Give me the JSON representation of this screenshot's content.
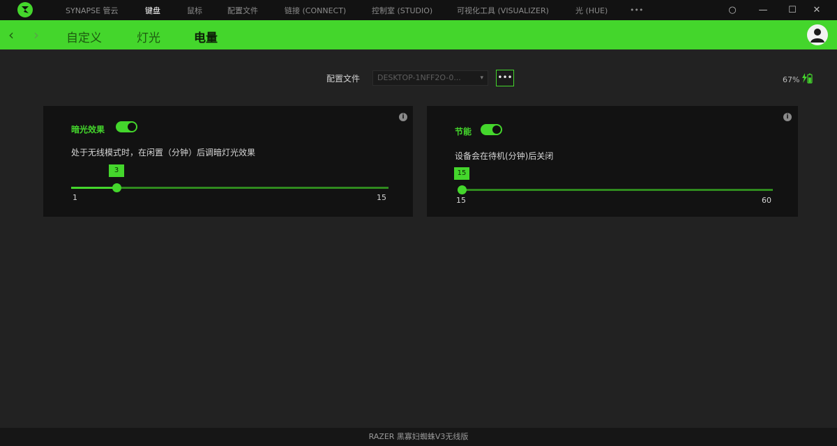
{
  "titlebar": {
    "nav_items": [
      {
        "label": "SYNAPSE 管云",
        "active": false
      },
      {
        "label": "键盘",
        "active": true
      },
      {
        "label": "鼠标",
        "active": false
      },
      {
        "label": "配置文件",
        "active": false
      },
      {
        "label": "链接 (CONNECT)",
        "active": false
      },
      {
        "label": "控制室 (STUDIO)",
        "active": false
      },
      {
        "label": "可视化工具 (VISUALIZER)",
        "active": false
      },
      {
        "label": "光 (HUE)",
        "active": false
      },
      {
        "label": "•••",
        "active": false
      }
    ],
    "window_controls": {
      "record": "○",
      "minimize": "—",
      "maximize": "☐",
      "close": "✕"
    }
  },
  "subnav": {
    "back": "‹",
    "forward": "›",
    "tabs": [
      {
        "label": "自定义",
        "active": false
      },
      {
        "label": "灯光",
        "active": false
      },
      {
        "label": "电量",
        "active": true
      }
    ]
  },
  "profile": {
    "label": "配置文件",
    "selected": "DESKTOP-1NFF2O-0...",
    "more_label": "•••"
  },
  "battery": {
    "percent_text": "67%",
    "level": 0.67,
    "charging": true
  },
  "panels": [
    {
      "title": "暗光效果",
      "toggle_on": true,
      "description": "处于无线模式时，在闲置（分钟）后调暗灯光效果",
      "slider": {
        "value": 3,
        "value_text": "3",
        "min": 1,
        "max": 15,
        "min_text": "1",
        "max_text": "15"
      },
      "info_icon": "info-icon"
    },
    {
      "title": "节能",
      "toggle_on": true,
      "description": "设备会在待机(分钟)后关闭",
      "slider": {
        "value": 15,
        "value_text": "15",
        "min": 15,
        "max": 60,
        "min_text": "15",
        "max_text": "60"
      },
      "info_icon": "info-icon"
    }
  ],
  "footer": {
    "text": "RAZER 黑寡妇蜘蛛V3无线版"
  },
  "colors": {
    "accent": "#44d62c",
    "background": "#222222",
    "panel": "#121212",
    "titlebar": "#121212"
  }
}
